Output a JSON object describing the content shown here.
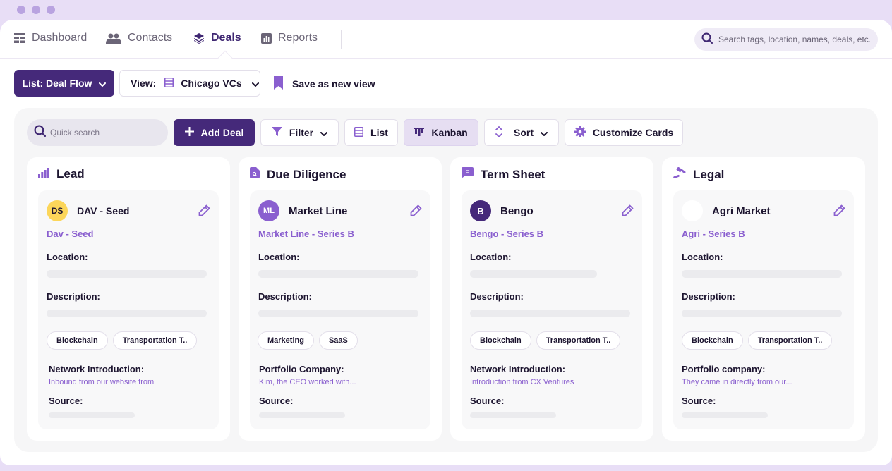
{
  "nav": {
    "items": [
      {
        "label": "Dashboard",
        "icon": "dashboard-icon",
        "active": false
      },
      {
        "label": "Contacts",
        "icon": "contacts-icon",
        "active": false
      },
      {
        "label": "Deals",
        "icon": "layers-icon",
        "active": true
      },
      {
        "label": "Reports",
        "icon": "reports-icon",
        "active": false
      }
    ],
    "search_placeholder": "Search tags, location, names, deals, etc."
  },
  "list_bar": {
    "list_button": "List: Deal Flow",
    "view_label": "View:",
    "view_value": "Chicago VCs",
    "save_view": "Save as new view"
  },
  "toolbar": {
    "quick_search_placeholder": "Quick search",
    "add_deal": "Add Deal",
    "filter": "Filter",
    "list": "List",
    "kanban": "Kanban",
    "sort": "Sort",
    "customize": "Customize Cards",
    "active_view": "Kanban"
  },
  "colors": {
    "primary": "#45297a",
    "accent": "#8a5fcf",
    "avatar_ds": "#fcd65a",
    "avatar_ml": "#8a5fcf",
    "avatar_b": "#45297a"
  },
  "columns": [
    {
      "title": "Lead",
      "icon": "bar-chart-icon",
      "card": {
        "avatar": "DS",
        "name": "DAV - Seed",
        "subtitle": "Dav - Seed",
        "location_label": "Location:",
        "description_label": "Description:",
        "tags": [
          "Blockchain",
          "Transportation T.."
        ],
        "intro_label": "Network Introduction:",
        "intro_value": "Inbound from our website from",
        "source_label": "Source:"
      }
    },
    {
      "title": "Due Diligence",
      "icon": "document-search-icon",
      "card": {
        "avatar": "ML",
        "name": "Market Line",
        "subtitle": "Market Line - Series B",
        "location_label": "Location:",
        "description_label": "Description:",
        "tags": [
          "Marketing",
          "SaaS"
        ],
        "intro_label": "Portfolio Company:",
        "intro_value": "Kim, the CEO worked with...",
        "source_label": "Source:"
      }
    },
    {
      "title": "Term Sheet",
      "icon": "message-icon",
      "card": {
        "avatar": "B",
        "name": "Bengo",
        "subtitle": "Bengo - Series B",
        "location_label": "Location:",
        "description_label": "Description:",
        "tags": [
          "Blockchain",
          "Transportation T.."
        ],
        "intro_label": "Network Introduction:",
        "intro_value": "Introduction from CX Ventures",
        "source_label": "Source:"
      }
    },
    {
      "title": "Legal",
      "icon": "gavel-icon",
      "card": {
        "avatar": "",
        "name": "Agri Market",
        "subtitle": "Agri - Series B",
        "location_label": "Location:",
        "description_label": "Description:",
        "tags": [
          "Blockchain",
          "Transportation T.."
        ],
        "intro_label": "Portfolio company:",
        "intro_value": "They came in directly from our...",
        "source_label": "Source:"
      }
    }
  ]
}
